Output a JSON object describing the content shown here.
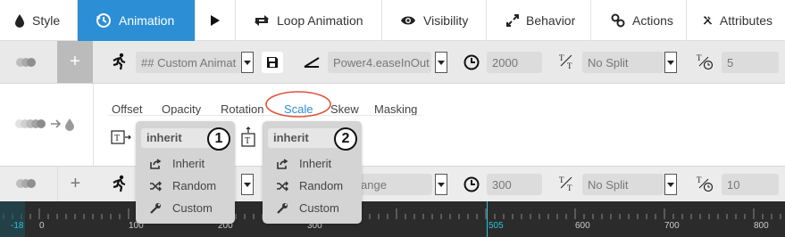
{
  "tabs": [
    {
      "label": "Style",
      "icon": "drop-icon"
    },
    {
      "label": "Animation",
      "icon": "history-icon",
      "active": true
    },
    {
      "label": "",
      "icon": "play-icon"
    },
    {
      "label": "Loop Animation",
      "icon": "loop-icon"
    },
    {
      "label": "Visibility",
      "icon": "eye-icon"
    },
    {
      "label": "Behavior",
      "icon": "expand-icon"
    },
    {
      "label": "Actions",
      "icon": "link-icon"
    },
    {
      "label": "Attributes",
      "icon": "tools-icon"
    }
  ],
  "row1": {
    "preset": "## Custom Animat",
    "easing": "Power4.easeInOut",
    "duration": "2000",
    "split": "No Split",
    "delay": "5"
  },
  "subtabs": [
    "Offset",
    "Opacity",
    "Rotation",
    "Scale",
    "Skew",
    "Masking"
  ],
  "active_subtab": "Scale",
  "popup1": {
    "header": "inherit",
    "number": "1",
    "items": [
      "Inherit",
      "Random",
      "Custom"
    ]
  },
  "popup2": {
    "header": "inherit",
    "number": "2",
    "items": [
      "Inherit",
      "Random",
      "Custom"
    ]
  },
  "row3": {
    "easing_partial": "ange",
    "duration": "300",
    "split": "No Split",
    "delay": "10"
  },
  "timeline": {
    "start": "-18",
    "labels": [
      "0",
      "100",
      "200",
      "300",
      "505",
      "600",
      "700",
      "800"
    ],
    "marker": "505"
  },
  "colors": {
    "accent": "#2c8fd6",
    "highlight_circle": "#e0533a",
    "timeline_marker": "#29c4d8"
  }
}
